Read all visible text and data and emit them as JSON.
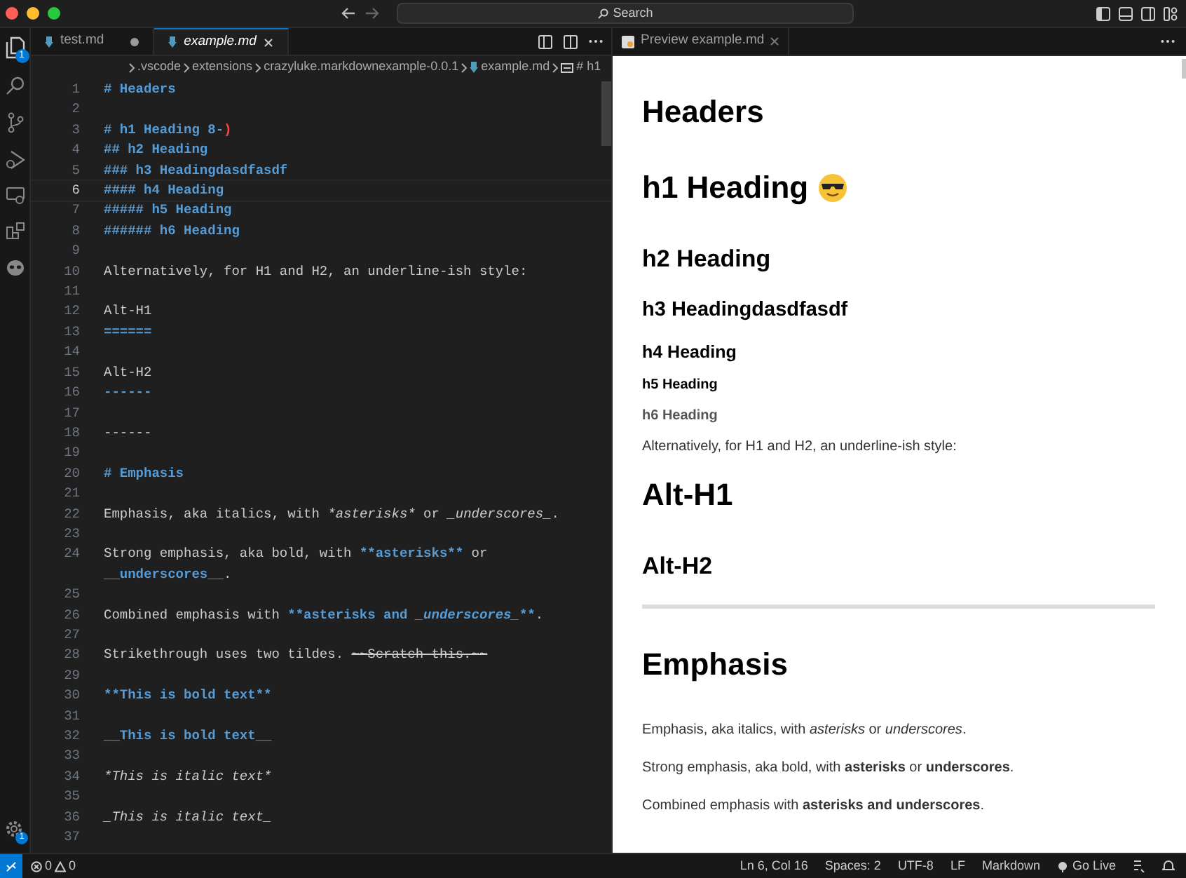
{
  "title_bar": {
    "search": "Search"
  },
  "activity_bar": {
    "explorer_badge": "1",
    "settings_badge": "1"
  },
  "editor_tabs": [
    {
      "label": "test.md",
      "selected": false,
      "dirty": true
    },
    {
      "label": "example.md",
      "selected": true,
      "dirty": false
    }
  ],
  "breadcrumb": [
    ".vscode",
    "extensions",
    "crazyluke.markdownexample-0.0.1",
    "example.md",
    "# h1"
  ],
  "editor": {
    "lines": [
      {
        "n": "1",
        "segs": [
          {
            "kind": "md",
            "text": "# Headers"
          }
        ]
      },
      {
        "n": "2"
      },
      {
        "n": "3",
        "segs": [
          {
            "kind": "md",
            "text": "# h1 Heading 8-"
          },
          {
            "kind": "error",
            "text": ")"
          }
        ]
      },
      {
        "n": "4",
        "segs": [
          {
            "kind": "md",
            "text": "## h2 Heading"
          }
        ]
      },
      {
        "n": "5",
        "segs": [
          {
            "kind": "md",
            "text": "### h3 Headingdasdfasdf"
          }
        ]
      },
      {
        "n": "6",
        "current": true,
        "segs": [
          {
            "kind": "md",
            "text": "#### h4 Heading"
          }
        ]
      },
      {
        "n": "7",
        "segs": [
          {
            "kind": "md",
            "text": "##### h5 Heading"
          }
        ]
      },
      {
        "n": "8",
        "segs": [
          {
            "kind": "md",
            "text": "###### h6 Heading"
          }
        ]
      },
      {
        "n": "9"
      },
      {
        "n": "10",
        "segs": [
          {
            "kind": "plain",
            "text": "Alternatively, for H1 and H2, an underline-ish style:"
          }
        ]
      },
      {
        "n": "11"
      },
      {
        "n": "12",
        "segs": [
          {
            "kind": "plain",
            "text": "Alt-H1"
          }
        ]
      },
      {
        "n": "13",
        "segs": [
          {
            "kind": "md",
            "text": "======"
          }
        ]
      },
      {
        "n": "14"
      },
      {
        "n": "15",
        "segs": [
          {
            "kind": "plain",
            "text": "Alt-H2"
          }
        ]
      },
      {
        "n": "16",
        "segs": [
          {
            "kind": "md",
            "text": "------"
          }
        ]
      },
      {
        "n": "17"
      },
      {
        "n": "18",
        "segs": [
          {
            "kind": "plain",
            "text": "------"
          }
        ]
      },
      {
        "n": "19"
      },
      {
        "n": "20",
        "segs": [
          {
            "kind": "md",
            "text": "# Emphasis"
          }
        ]
      },
      {
        "n": "21"
      },
      {
        "n": "22",
        "segs": [
          {
            "kind": "plain",
            "text": "Emphasis, aka italics, with "
          },
          {
            "kind": "italic",
            "text": "*asterisks*"
          },
          {
            "kind": "plain",
            "text": " or "
          },
          {
            "kind": "italic",
            "text": "_underscores_"
          },
          {
            "kind": "plain",
            "text": "."
          }
        ]
      },
      {
        "n": "23"
      },
      {
        "n": "24",
        "segs": [
          {
            "kind": "plain",
            "text": "Strong emphasis, aka bold, with "
          },
          {
            "kind": "md",
            "text": "**asterisks**"
          },
          {
            "kind": "plain",
            "text": " or "
          },
          {
            "kind": "md",
            "text": "__underscores__"
          },
          {
            "kind": "plain",
            "text": "."
          }
        ]
      },
      {
        "n": "25"
      },
      {
        "n": "26",
        "segs": [
          {
            "kind": "plain",
            "text": "Combined emphasis with "
          },
          {
            "kind": "md",
            "text": "**asterisks and "
          },
          {
            "kind": "md-italic",
            "text": "_underscores_"
          },
          {
            "kind": "md",
            "text": "**"
          },
          {
            "kind": "plain",
            "text": "."
          }
        ]
      },
      {
        "n": "27"
      },
      {
        "n": "28",
        "segs": [
          {
            "kind": "plain",
            "text": "Strikethrough uses two tildes. "
          },
          {
            "kind": "strike",
            "text": "~~Scratch this.~~"
          }
        ]
      },
      {
        "n": "29"
      },
      {
        "n": "30",
        "segs": [
          {
            "kind": "md",
            "text": "**This is bold text**"
          }
        ]
      },
      {
        "n": "31"
      },
      {
        "n": "32",
        "segs": [
          {
            "kind": "md",
            "text": "__This is bold text__"
          }
        ]
      },
      {
        "n": "33"
      },
      {
        "n": "34",
        "segs": [
          {
            "kind": "italic",
            "text": "*This is italic text*"
          }
        ]
      },
      {
        "n": "35"
      },
      {
        "n": "36",
        "segs": [
          {
            "kind": "italic",
            "text": "_This is italic text_"
          }
        ]
      },
      {
        "n": "37"
      }
    ]
  },
  "preview_tab": {
    "label": "Preview example.md"
  },
  "preview": [
    {
      "kind": "h1",
      "text": "Headers"
    },
    {
      "kind": "h1",
      "text": "h1 Heading",
      "emoji": true
    },
    {
      "kind": "h2",
      "text": "h2 Heading"
    },
    {
      "kind": "h3",
      "text": "h3 Headingdasdfasdf"
    },
    {
      "kind": "h4",
      "text": "h4 Heading"
    },
    {
      "kind": "h5",
      "text": "h5 Heading"
    },
    {
      "kind": "h6",
      "text": "h6 Heading"
    },
    {
      "kind": "p",
      "text": "Alternatively, for H1 and H2, an underline-ish style:"
    },
    {
      "kind": "h1",
      "text": "Alt-H1"
    },
    {
      "kind": "h2",
      "text": "Alt-H2"
    },
    {
      "kind": "hr"
    },
    {
      "kind": "h1",
      "text": "Emphasis"
    },
    {
      "kind": "p",
      "text": "Emphasis, aka italics, with *asterisks* or *underscores*."
    },
    {
      "kind": "p",
      "text": "Strong emphasis, aka bold, with **asterisks** or **underscores**."
    },
    {
      "kind": "p",
      "text": "Combined emphasis with **asterisks and underscores**."
    }
  ],
  "status_bar": {
    "errors": "0",
    "warnings": "0",
    "right": [
      "Ln 6, Col 16",
      "Spaces: 2",
      "UTF-8",
      "LF",
      "Markdown"
    ],
    "go_live": "Go Live"
  }
}
